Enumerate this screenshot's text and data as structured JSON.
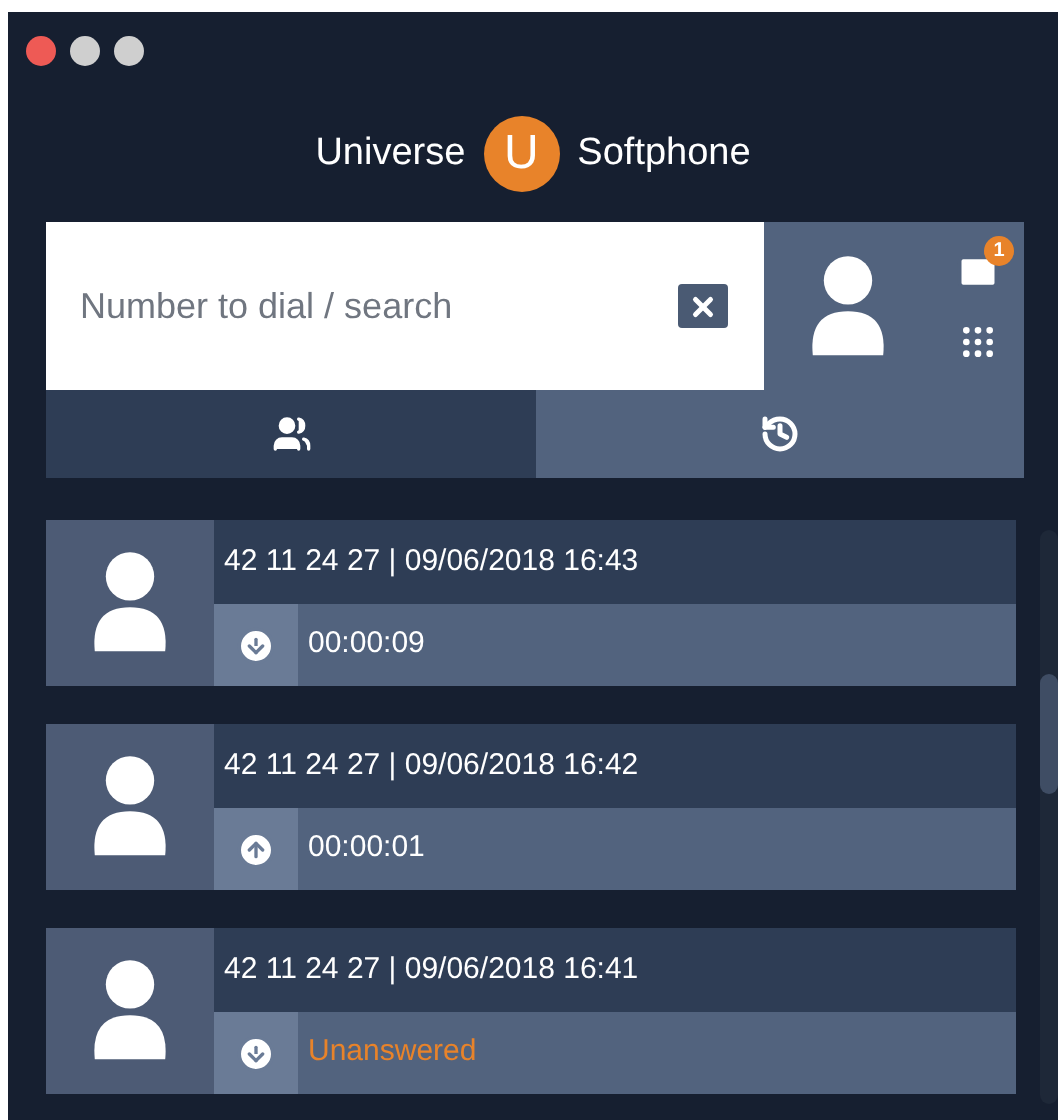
{
  "window": {
    "title_left": "Universe",
    "logo_letter": "U",
    "title_right": "Softphone"
  },
  "search": {
    "placeholder": "Number to dial / search"
  },
  "messages": {
    "badge": "1"
  },
  "tabs": [
    {
      "kind": "contacts",
      "selected": false
    },
    {
      "kind": "history",
      "selected": true
    }
  ],
  "calls": [
    {
      "header": "42 11 24 27 | 09/06/2018 16:43",
      "kind": "incoming",
      "status": "00:00:09",
      "missed": false
    },
    {
      "header": "42 11 24 27 | 09/06/2018 16:42",
      "kind": "outgoing",
      "status": "00:00:01",
      "missed": false
    },
    {
      "header": "42 11 24 27 | 09/06/2018 16:41",
      "kind": "incoming",
      "status": "Unanswered",
      "missed": true
    }
  ]
}
